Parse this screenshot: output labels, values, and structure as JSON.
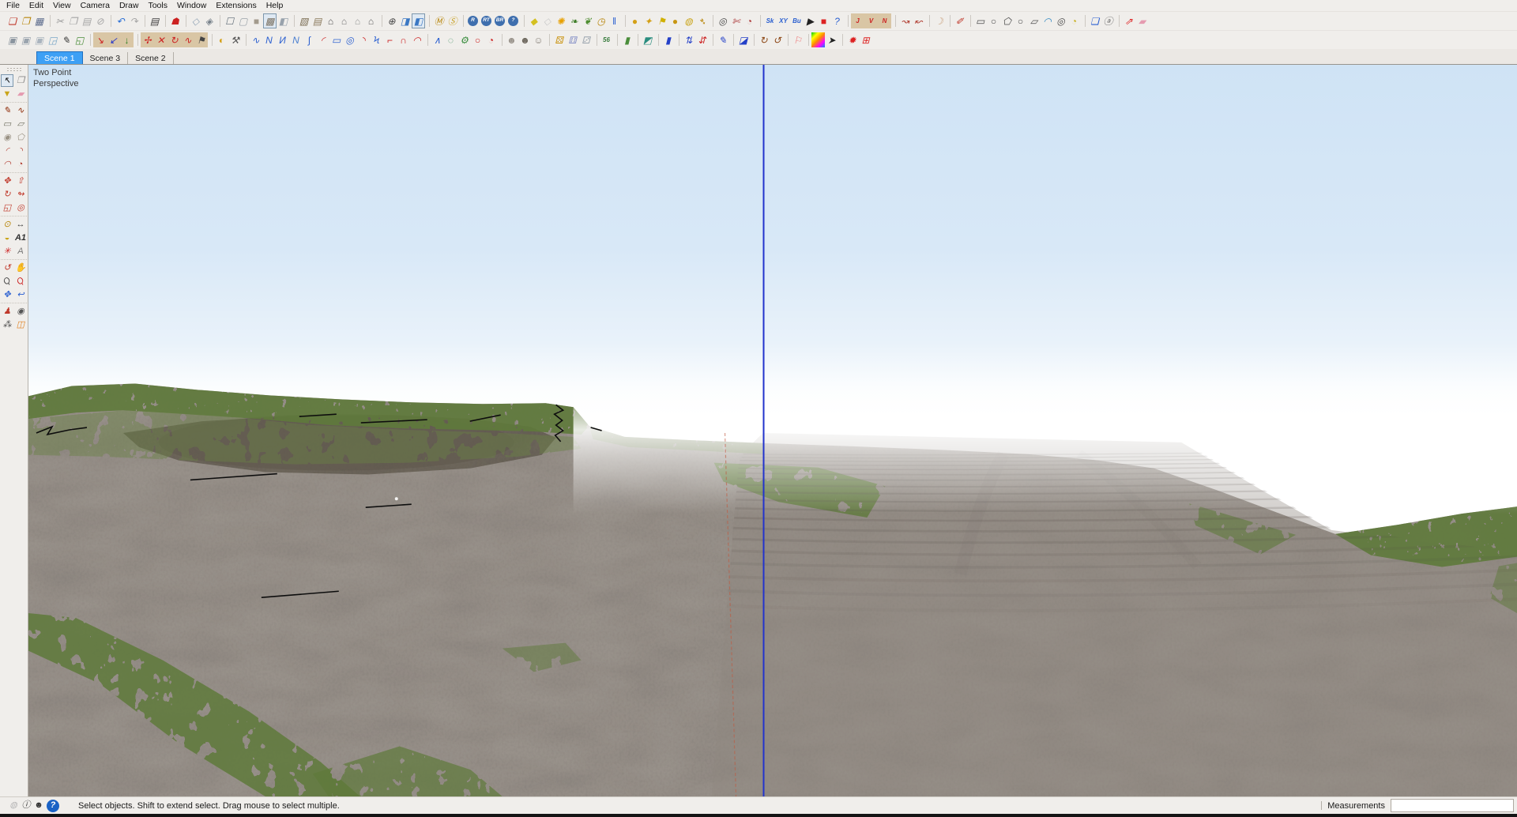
{
  "menu": {
    "items": [
      "File",
      "Edit",
      "View",
      "Camera",
      "Draw",
      "Tools",
      "Window",
      "Extensions",
      "Help"
    ]
  },
  "scene_tabs": {
    "tabs": [
      "Scene 1",
      "Scene 3",
      "Scene 2"
    ],
    "active_index": 0
  },
  "viewport": {
    "camera_label": "Two Point Perspective"
  },
  "statusbar": {
    "message": "Select objects. Shift to extend select. Drag mouse to select multiple.",
    "measurements_label": "Measurements",
    "measurements_value": ""
  },
  "colors": {
    "accent_tab_blue": "#3da0f5",
    "axis_blue": "#2233cc",
    "axis_red_dashed": "#c05a40",
    "sky_top": "#cfe3f5",
    "dirt": "#98918a",
    "grass": "#5f7a3b"
  },
  "toolbars": {
    "row1": [
      [
        "new",
        "open",
        "save"
      ],
      [
        "cut",
        "copy",
        "paste",
        "erase-all"
      ],
      [
        "undo",
        "redo"
      ],
      [
        "print"
      ],
      [
        "warehouse"
      ],
      [
        "xray",
        "back-edges"
      ],
      [
        "wireframe",
        "hidden-line",
        "shaded",
        "shaded-textures",
        "monochrome"
      ],
      [
        "iso-view",
        "top-view",
        "front-view",
        "right-view",
        "back-view",
        "left-view"
      ],
      [
        "zoom-extents-cam",
        "prev-view",
        "two-point-view"
      ],
      [
        "coin-m",
        "coin-s"
      ],
      [
        "plugin-r",
        "plugin-rt",
        "plugin-br",
        "plugin-q"
      ],
      [
        "tag",
        "diamond",
        "burst",
        "grass-a",
        "grass-b",
        "clock",
        "pause"
      ],
      [
        "sphere-a",
        "spin-top",
        "flag-gold",
        "sphere-b",
        "sphere-c",
        "pin-gold"
      ],
      [
        "compass",
        "section-cut",
        "stopwatch"
      ],
      [
        "skin",
        "skin-xy",
        "skin-bub",
        "play",
        "stop-red",
        "help-blue"
      ],
      [
        "terrain-j",
        "terrain-v",
        "terrain-n"
      ],
      [
        "curve-a",
        "curve-b"
      ],
      [
        "shell"
      ],
      [
        "pencil-red"
      ],
      [
        "shape-rect",
        "shape-circle",
        "shape-polygon",
        "shape-ellipse",
        "shape-parallelogram",
        "shape-arc",
        "shape-circle2",
        "shape-pie"
      ],
      [
        "drape-blue",
        "copy-a"
      ],
      [
        "axes-arrow",
        "eraser-pink"
      ]
    ],
    "row2": [
      [
        "box-a",
        "box-b",
        "box-c",
        "wedge-blue",
        "scratch",
        "wedge-green"
      ],
      [
        "terr-red",
        "terr-blue",
        "terr-green"
      ],
      [
        "terr-a",
        "terr-b",
        "terr-c",
        "terr-d",
        "terr-e"
      ],
      [
        "coin-half",
        "tools"
      ],
      [
        "bz-wave",
        "bz-n1",
        "bz-n2",
        "bz-n3",
        "bz-j",
        "bz-c1",
        "bz-rect",
        "bz-spiral",
        "bz-c2",
        "bz-n4",
        "bz-r1",
        "bz-u1",
        "bz-c3"
      ],
      [
        "bz-n5",
        "bz-ring",
        "wrench-green",
        "bz-o",
        "bz-pie"
      ],
      [
        "head-a",
        "head-b",
        "head-c"
      ],
      [
        "dice-a",
        "dice-b",
        "dice-c"
      ],
      [
        "icon-56"
      ],
      [
        "green-pill"
      ],
      [
        "flag-teal"
      ],
      [
        "bar-blue"
      ],
      [
        "arrows-up",
        "arrows-down"
      ],
      [
        "pen-blue"
      ],
      [
        "x-teal"
      ],
      [
        "spiral-a",
        "spiral-b"
      ],
      [
        "flag-pink"
      ],
      [
        "gradient",
        "cursor-black"
      ],
      [
        "sun-red",
        "table-red"
      ]
    ],
    "left": [
      [
        "lt-select",
        "lt-component",
        "lt-paint",
        "lt-eraser"
      ],
      [
        "lt-line",
        "lt-freehand",
        "lt-rect",
        "lt-rotrect",
        "lt-circle",
        "lt-polygon",
        "lt-arc2",
        "lt-arc",
        "lt-arc3",
        "lt-pie"
      ],
      [
        "lt-move",
        "lt-pushpull",
        "lt-rotate",
        "lt-followme",
        "lt-scale",
        "lt-offset"
      ],
      [
        "lt-tape",
        "lt-dimension",
        "lt-protractor",
        "lt-text",
        "lt-axes",
        "lt-3dtext"
      ],
      [
        "lt-orbit",
        "lt-pan",
        "lt-zoom",
        "lt-zoomwin",
        "lt-zoomext",
        "lt-zoomprev"
      ],
      [
        "lt-poscam",
        "lt-look",
        "lt-walk",
        "lt-section"
      ]
    ],
    "status": [
      [
        "st-geo",
        "st-info",
        "st-person",
        "st-help"
      ]
    ]
  },
  "icons": {
    "new": {
      "glyph": "❏",
      "fg": "#c0392b"
    },
    "open": {
      "glyph": "❐",
      "fg": "#b8860b"
    },
    "save": {
      "glyph": "▦",
      "fg": "#5b6b8c"
    },
    "cut": {
      "glyph": "✂",
      "fg": "#9a9a9a"
    },
    "copy": {
      "glyph": "❐",
      "fg": "#a5a5a5"
    },
    "paste": {
      "glyph": "▤",
      "fg": "#a5a5a5"
    },
    "erase-all": {
      "glyph": "⊘",
      "fg": "#a5a5a5"
    },
    "undo": {
      "glyph": "↶",
      "fg": "#2a6fd6"
    },
    "redo": {
      "glyph": "↷",
      "fg": "#a5a5a5"
    },
    "print": {
      "glyph": "▤",
      "fg": "#3a3a3a"
    },
    "warehouse": {
      "glyph": "☗",
      "fg": "#cc2222"
    },
    "xray": {
      "glyph": "◇",
      "fg": "#8fa3b5"
    },
    "back-edges": {
      "glyph": "◈",
      "fg": "#76808a"
    },
    "wireframe": {
      "glyph": "☐",
      "fg": "#5d6a75"
    },
    "hidden-line": {
      "glyph": "▢",
      "fg": "#9aa2a8"
    },
    "shaded": {
      "glyph": "■",
      "fg": "#a39b8d"
    },
    "shaded-textures": {
      "glyph": "▩",
      "fg": "#7d7465",
      "pressed": true
    },
    "monochrome": {
      "glyph": "◧",
      "fg": "#98a2ac"
    },
    "iso-view": {
      "glyph": "▧",
      "fg": "#7a6c52"
    },
    "top-view": {
      "glyph": "▤",
      "fg": "#8a7a5c"
    },
    "front-view": {
      "glyph": "⌂",
      "fg": "#555555"
    },
    "right-view": {
      "glyph": "⌂",
      "fg": "#777777"
    },
    "back-view": {
      "glyph": "⌂",
      "fg": "#999999"
    },
    "left-view": {
      "glyph": "⌂",
      "fg": "#666666"
    },
    "zoom-extents-cam": {
      "glyph": "⊕",
      "fg": "#444444"
    },
    "prev-view": {
      "glyph": "◨",
      "fg": "#3b78c4"
    },
    "two-point-view": {
      "glyph": "◧",
      "fg": "#3b78c4",
      "pressed": true
    },
    "coin-m": {
      "glyph": "Ⓜ",
      "fg": "#b8860b"
    },
    "coin-s": {
      "glyph": "Ⓢ",
      "fg": "#c9a227"
    },
    "plugin-r": {
      "glyph": "R",
      "fg": "#ffffff",
      "bg": "#3f6fae",
      "shape": "circle"
    },
    "plugin-rt": {
      "glyph": "RT",
      "fg": "#ffffff",
      "bg": "#3f6fae",
      "shape": "circle"
    },
    "plugin-br": {
      "glyph": "BR",
      "fg": "#ffffff",
      "bg": "#3f6fae",
      "shape": "circle"
    },
    "plugin-q": {
      "glyph": "?",
      "fg": "#ffffff",
      "bg": "#3f6fae",
      "shape": "circle"
    },
    "tag": {
      "glyph": "◆",
      "fg": "#d4c020"
    },
    "diamond": {
      "glyph": "◇",
      "fg": "#c9c9c9"
    },
    "burst": {
      "glyph": "✺",
      "fg": "#e8a000"
    },
    "grass-a": {
      "glyph": "❧",
      "fg": "#3e7d28"
    },
    "grass-b": {
      "glyph": "❦",
      "fg": "#4e8d30"
    },
    "clock": {
      "glyph": "◷",
      "fg": "#b8860b"
    },
    "pause": {
      "glyph": "‖",
      "fg": "#2a5fd0"
    },
    "sphere-a": {
      "glyph": "●",
      "fg": "#d4a017"
    },
    "spin-top": {
      "glyph": "✦",
      "fg": "#d4a017"
    },
    "flag-gold": {
      "glyph": "⚑",
      "fg": "#d0b000"
    },
    "sphere-b": {
      "glyph": "●",
      "fg": "#c89612"
    },
    "sphere-c": {
      "glyph": "◍",
      "fg": "#caa51a"
    },
    "pin-gold": {
      "glyph": "➴",
      "fg": "#b8860b"
    },
    "compass": {
      "glyph": "◎",
      "fg": "#444444"
    },
    "section-cut": {
      "glyph": "✄",
      "fg": "#aa3333"
    },
    "stopwatch": {
      "glyph": "◔",
      "fg": "#aa3333"
    },
    "skin": {
      "glyph": "Sk",
      "fg": "#2a5fd0",
      "cls": "small"
    },
    "skin-xy": {
      "glyph": "XY",
      "fg": "#2a5fd0",
      "cls": "small"
    },
    "skin-bub": {
      "glyph": "Bu",
      "fg": "#2a5fd0",
      "cls": "small"
    },
    "play": {
      "glyph": "▶",
      "fg": "#222222"
    },
    "stop-red": {
      "glyph": "■",
      "fg": "#dd2222"
    },
    "help-blue": {
      "glyph": "?",
      "fg": "#2a5fd0"
    },
    "terrain-j": {
      "glyph": "J",
      "fg": "#cc2222",
      "bg": "#d9c6a5",
      "cls": "small"
    },
    "terrain-v": {
      "glyph": "V",
      "fg": "#cc2222",
      "bg": "#d9c6a5",
      "cls": "small"
    },
    "terrain-n": {
      "glyph": "N",
      "fg": "#cc2222",
      "bg": "#d9c6a5",
      "cls": "small"
    },
    "curve-a": {
      "glyph": "↝",
      "fg": "#b03a2e"
    },
    "curve-b": {
      "glyph": "↜",
      "fg": "#b03a2e"
    },
    "shell": {
      "glyph": "☽",
      "fg": "#caa27e"
    },
    "pencil-red": {
      "glyph": "✐",
      "fg": "#c0392b"
    },
    "shape-rect": {
      "glyph": "▭",
      "fg": "#4a4a4a"
    },
    "shape-circle": {
      "glyph": "○",
      "fg": "#4a4a4a"
    },
    "shape-polygon": {
      "glyph": "⬠",
      "fg": "#4a4a4a"
    },
    "shape-ellipse": {
      "glyph": "○",
      "fg": "#4a4a4a"
    },
    "shape-parallelogram": {
      "glyph": "▱",
      "fg": "#4a4a4a"
    },
    "shape-arc": {
      "glyph": "◠",
      "fg": "#2e86c1"
    },
    "shape-circle2": {
      "glyph": "◎",
      "fg": "#4a4a4a"
    },
    "shape-pie": {
      "glyph": "◔",
      "fg": "#c9b227"
    },
    "drape-blue": {
      "glyph": "❏",
      "fg": "#2a5fd0"
    },
    "copy-a": {
      "glyph": "ⓐ",
      "fg": "#666666"
    },
    "axes-arrow": {
      "glyph": "⇗",
      "fg": "#dd2222"
    },
    "eraser-pink": {
      "glyph": "▰",
      "fg": "#e59bb0"
    },
    "box-a": {
      "glyph": "▣",
      "fg": "#8a949e"
    },
    "box-b": {
      "glyph": "▣",
      "fg": "#9aa4ae"
    },
    "box-c": {
      "glyph": "▣",
      "fg": "#aab4be"
    },
    "wedge-blue": {
      "glyph": "◲",
      "fg": "#7aa7c7"
    },
    "scratch": {
      "glyph": "✎",
      "fg": "#333333"
    },
    "wedge-green": {
      "glyph": "◱",
      "fg": "#4a8d3a"
    },
    "terr-red": {
      "glyph": "↘",
      "fg": "#cc2222",
      "bg": "#d9c6a5"
    },
    "terr-blue": {
      "glyph": "↙",
      "fg": "#2233cc",
      "bg": "#d9c6a5"
    },
    "terr-green": {
      "glyph": "↓",
      "fg": "#2a7d1f",
      "bg": "#d9c6a5"
    },
    "terr-a": {
      "glyph": "✢",
      "fg": "#cc2222",
      "bg": "#d9c6a5"
    },
    "terr-b": {
      "glyph": "✕",
      "fg": "#cc2222",
      "bg": "#d9c6a5"
    },
    "terr-c": {
      "glyph": "↻",
      "fg": "#cc2222",
      "bg": "#d9c6a5"
    },
    "terr-d": {
      "glyph": "∿",
      "fg": "#cc2222",
      "bg": "#d9c6a5"
    },
    "terr-e": {
      "glyph": "⚑",
      "fg": "#444444",
      "bg": "#d9c6a5"
    },
    "coin-half": {
      "glyph": "◐",
      "fg": "#d4a017"
    },
    "tools": {
      "glyph": "⚒",
      "fg": "#555555"
    },
    "bz-wave": {
      "glyph": "∿",
      "fg": "#2a5fd0"
    },
    "bz-n1": {
      "glyph": "N",
      "fg": "#2a5fd0"
    },
    "bz-n2": {
      "glyph": "И",
      "fg": "#2a5fd0"
    },
    "bz-n3": {
      "glyph": "N",
      "fg": "#4a7fd0"
    },
    "bz-j": {
      "glyph": "∫",
      "fg": "#2a5fd0"
    },
    "bz-c1": {
      "glyph": "◜",
      "fg": "#cc2222"
    },
    "bz-rect": {
      "glyph": "▭",
      "fg": "#2a5fd0"
    },
    "bz-spiral": {
      "glyph": "◎",
      "fg": "#2a5fd0"
    },
    "bz-c2": {
      "glyph": "◝",
      "fg": "#cc2222"
    },
    "bz-n4": {
      "glyph": "Ϟ",
      "fg": "#2a5fd0"
    },
    "bz-r1": {
      "glyph": "⌐",
      "fg": "#cc2222"
    },
    "bz-u1": {
      "glyph": "∩",
      "fg": "#cc2222"
    },
    "bz-c3": {
      "glyph": "◠",
      "fg": "#cc2222"
    },
    "bz-n5": {
      "glyph": "∧",
      "fg": "#2a5fd0"
    },
    "bz-ring": {
      "glyph": "◌",
      "fg": "#3a8d5f"
    },
    "wrench-green": {
      "glyph": "⚙",
      "fg": "#3a8d3f"
    },
    "bz-o": {
      "glyph": "○",
      "fg": "#cc2222"
    },
    "bz-pie": {
      "glyph": "◔",
      "fg": "#cc2222"
    },
    "head-a": {
      "glyph": "☻",
      "fg": "#9a948c"
    },
    "head-b": {
      "glyph": "☻",
      "fg": "#6b655b"
    },
    "head-c": {
      "glyph": "☺",
      "fg": "#8a847c"
    },
    "dice-a": {
      "glyph": "⚄",
      "fg": "#c9920e"
    },
    "dice-b": {
      "glyph": "⚅",
      "fg": "#8a94c8"
    },
    "dice-c": {
      "glyph": "⚂",
      "fg": "#9aa4ae"
    },
    "icon-56": {
      "glyph": "56",
      "fg": "#3a7d3f",
      "cls": "small"
    },
    "green-pill": {
      "glyph": "▮",
      "fg": "#4a8d3a"
    },
    "flag-teal": {
      "glyph": "◩",
      "fg": "#2a8d7f"
    },
    "bar-blue": {
      "glyph": "▮",
      "fg": "#2440c8"
    },
    "arrows-up": {
      "glyph": "⇅",
      "fg": "#2440c8"
    },
    "arrows-down": {
      "glyph": "⇵",
      "fg": "#cc2222"
    },
    "pen-blue": {
      "glyph": "✎",
      "fg": "#2440c8"
    },
    "x-teal": {
      "glyph": "◪",
      "fg": "#2440c8"
    },
    "spiral-a": {
      "glyph": "↻",
      "fg": "#8b4513"
    },
    "spiral-b": {
      "glyph": "↺",
      "fg": "#8b4513"
    },
    "flag-pink": {
      "glyph": "⚐",
      "fg": "#ee7777"
    },
    "gradient": {
      "glyph": "",
      "fg": "#000000",
      "bg": "linear-gradient(135deg,#00cc00,#ffff00,#ff8800,#ff00ff,#0088ff)"
    },
    "cursor-black": {
      "glyph": "➤",
      "fg": "#222222"
    },
    "sun-red": {
      "glyph": "✹",
      "fg": "#dd2222"
    },
    "table-red": {
      "glyph": "⊞",
      "fg": "#dd2222"
    },
    "lt-select": {
      "glyph": "↖",
      "fg": "#111111",
      "pressed": true
    },
    "lt-component": {
      "glyph": "❒",
      "fg": "#8a8a8a"
    },
    "lt-paint": {
      "glyph": "▼",
      "fg": "#caa51a"
    },
    "lt-eraser": {
      "glyph": "▰",
      "fg": "#e59bb0"
    },
    "lt-line": {
      "glyph": "✎",
      "fg": "#8b2500"
    },
    "lt-freehand": {
      "glyph": "∿",
      "fg": "#8b2500"
    },
    "lt-rect": {
      "glyph": "▭",
      "fg": "#6e6e5e"
    },
    "lt-rotrect": {
      "glyph": "▱",
      "fg": "#6e6e5e"
    },
    "lt-circle": {
      "glyph": "◉",
      "fg": "#9a9284"
    },
    "lt-polygon": {
      "glyph": "⬠",
      "fg": "#9a9284"
    },
    "lt-arc2": {
      "glyph": "◜",
      "fg": "#b03a2e"
    },
    "lt-arc": {
      "glyph": "◝",
      "fg": "#b03a2e"
    },
    "lt-arc3": {
      "glyph": "◠",
      "fg": "#b03a2e"
    },
    "lt-pie": {
      "glyph": "◔",
      "fg": "#b03a2e"
    },
    "lt-move": {
      "glyph": "✥",
      "fg": "#c0392b"
    },
    "lt-pushpull": {
      "glyph": "⇧",
      "fg": "#c0392b"
    },
    "lt-rotate": {
      "glyph": "↻",
      "fg": "#c0392b"
    },
    "lt-followme": {
      "glyph": "↬",
      "fg": "#c0392b"
    },
    "lt-scale": {
      "glyph": "◱",
      "fg": "#c0392b"
    },
    "lt-offset": {
      "glyph": "◎",
      "fg": "#c0392b"
    },
    "lt-tape": {
      "glyph": "⊙",
      "fg": "#b8860b"
    },
    "lt-dimension": {
      "glyph": "↔",
      "fg": "#444444"
    },
    "lt-protractor": {
      "glyph": "◒",
      "fg": "#caa51a"
    },
    "lt-text": {
      "glyph": "A1",
      "fg": "#333333",
      "cls": "small"
    },
    "lt-axes": {
      "glyph": "✳",
      "fg": "#cc2222"
    },
    "lt-3dtext": {
      "glyph": "A",
      "fg": "#777777"
    },
    "lt-orbit": {
      "glyph": "↺",
      "fg": "#c0392b"
    },
    "lt-pan": {
      "glyph": "✋",
      "fg": "#d2a679"
    },
    "lt-zoom": {
      "glyph": "Ϙ",
      "fg": "#444444",
      "cls": "rot"
    },
    "lt-zoomwin": {
      "glyph": "Ϙ",
      "fg": "#cc2222",
      "cls": "rot"
    },
    "lt-zoomext": {
      "glyph": "✥",
      "fg": "#2a5fd0"
    },
    "lt-zoomprev": {
      "glyph": "↩",
      "fg": "#2a5fd0"
    },
    "lt-poscam": {
      "glyph": "♟",
      "fg": "#c0392b"
    },
    "lt-look": {
      "glyph": "◉",
      "fg": "#555555"
    },
    "lt-walk": {
      "glyph": "⁂",
      "fg": "#444444"
    },
    "lt-section": {
      "glyph": "◫",
      "fg": "#e08020"
    },
    "st-geo": {
      "glyph": "◍",
      "fg": "#b5b5b5"
    },
    "st-info": {
      "glyph": "ⓘ",
      "fg": "#222222"
    },
    "st-person": {
      "glyph": "☻",
      "fg": "#333333"
    },
    "st-help": {
      "glyph": "?",
      "fg": "#ffffff",
      "bg": "#1a62c5",
      "shape": "circle"
    }
  }
}
